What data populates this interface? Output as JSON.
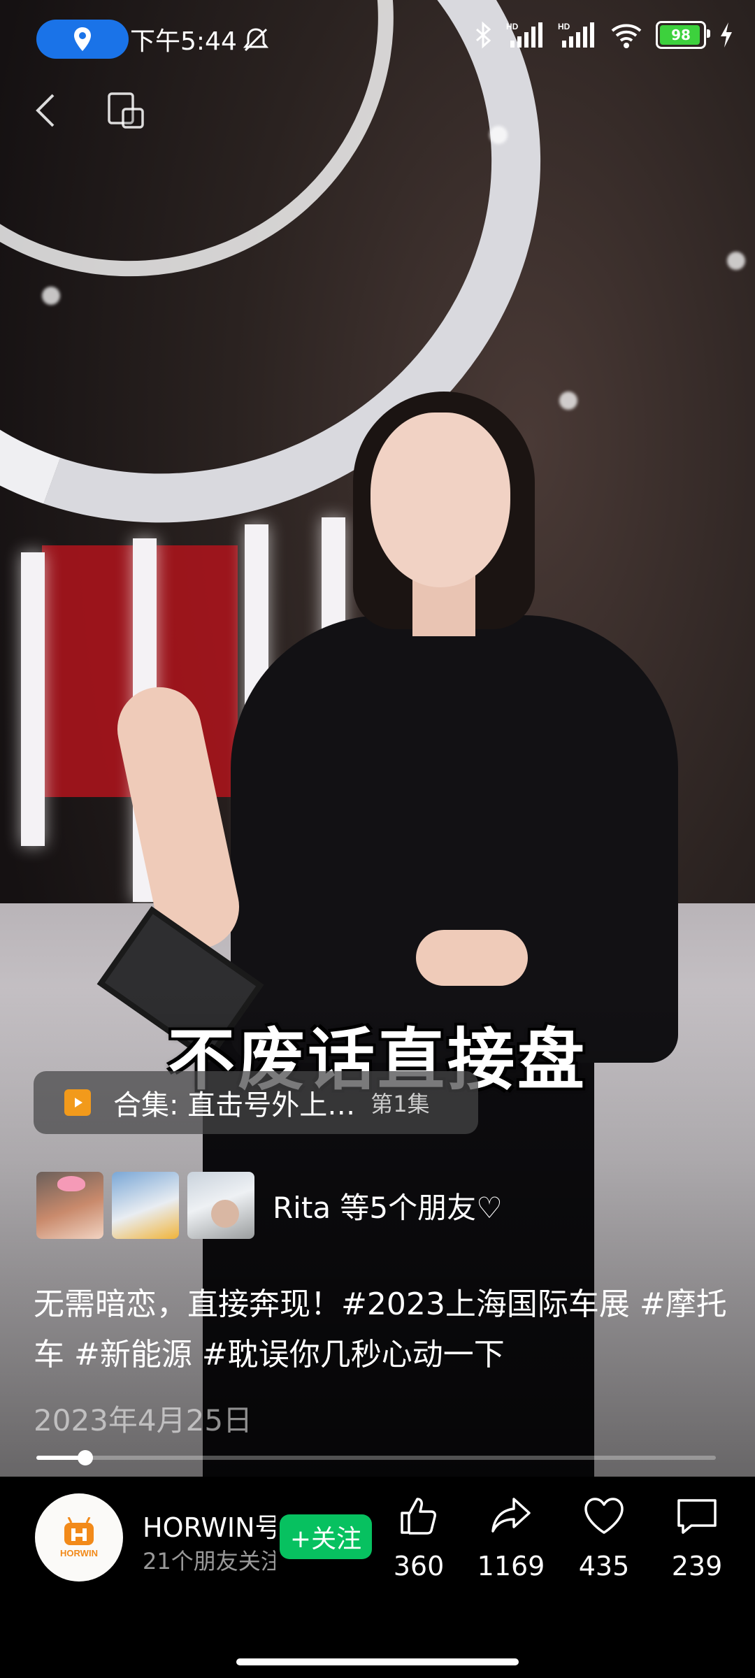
{
  "status_bar": {
    "time": "下午5:44",
    "battery": "98",
    "icons": [
      "location-icon",
      "mute-icon",
      "bluetooth-icon",
      "hd-signal-icon",
      "hd-signal-icon",
      "wifi-icon",
      "battery-icon",
      "charging-icon"
    ]
  },
  "video": {
    "caption": "不废话直接盘"
  },
  "collection": {
    "title": "合集: 直击号外上…",
    "episode": "第1集"
  },
  "friends": {
    "text": "Rita 等5个朋友♡"
  },
  "description": "无需暗恋，直接奔现！#2023上海国际车展 #摩托车 #新能源 #耽误你几秒心动一下",
  "date": "2023年4月25日",
  "progress": {
    "played_fraction": 0.072
  },
  "account": {
    "name": "HORWIN号",
    "subtitle": "21个朋友关注",
    "follow_label": "+关注",
    "logo_text": "HORWIN"
  },
  "actions": {
    "like": "360",
    "share": "1169",
    "favorite": "435",
    "comment": "239"
  },
  "colors": {
    "follow_green": "#07c160",
    "location_blue": "#1a73e8",
    "battery_green": "#3dd13d",
    "collection_orange": "#f29a1b"
  }
}
